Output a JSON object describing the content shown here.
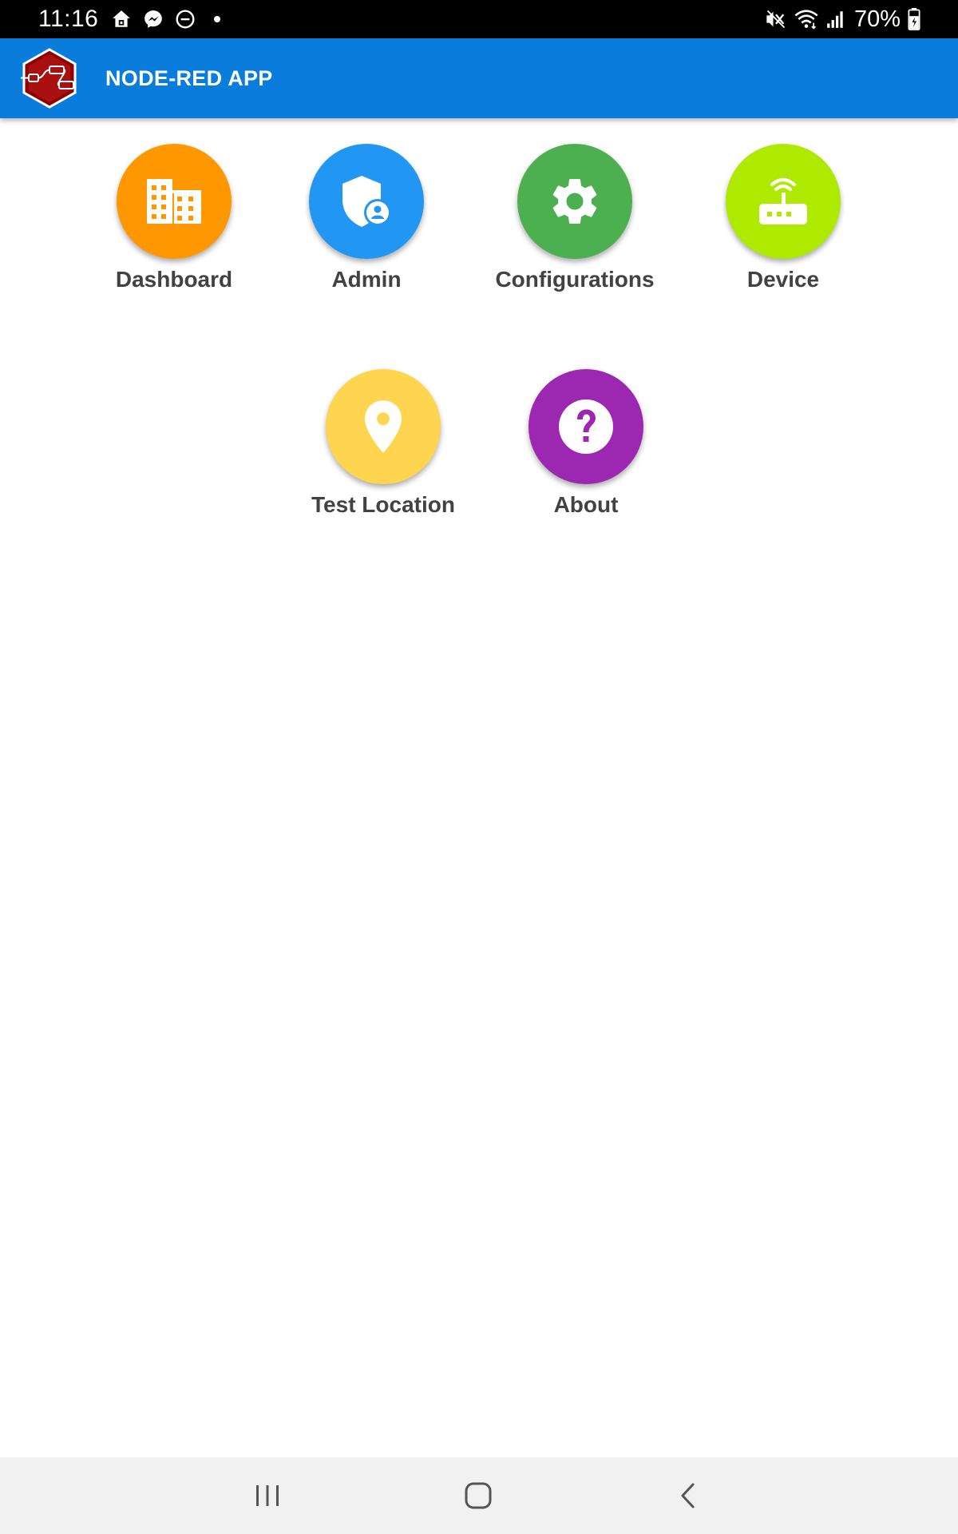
{
  "status_bar": {
    "time": "11:16",
    "battery": "70%",
    "icons_left": [
      "home-alert-icon",
      "messenger-icon",
      "do-not-disturb-icon",
      "dot-icon"
    ],
    "icons_right": [
      "mute-icon",
      "wifi-icon",
      "signal-icon",
      "battery-charging-icon"
    ]
  },
  "app_bar": {
    "title": "NODE-RED APP",
    "color": "#0a7ddc"
  },
  "tiles": [
    {
      "label": "Dashboard",
      "icon": "building-icon",
      "color": "#ff9800"
    },
    {
      "label": "Admin",
      "icon": "admin-shield-icon",
      "color": "#2196f3"
    },
    {
      "label": "Configurations",
      "icon": "gear-icon",
      "color": "#4caf50"
    },
    {
      "label": "Device",
      "icon": "router-icon",
      "color": "#aeea00"
    },
    {
      "label": "Test Location",
      "icon": "location-pin-icon",
      "color": "#ffd54f"
    },
    {
      "label": "About",
      "icon": "help-circle-icon",
      "color": "#9c27b0"
    }
  ],
  "nav_bar": {
    "buttons": [
      "recents-icon",
      "home-icon",
      "back-icon"
    ]
  }
}
